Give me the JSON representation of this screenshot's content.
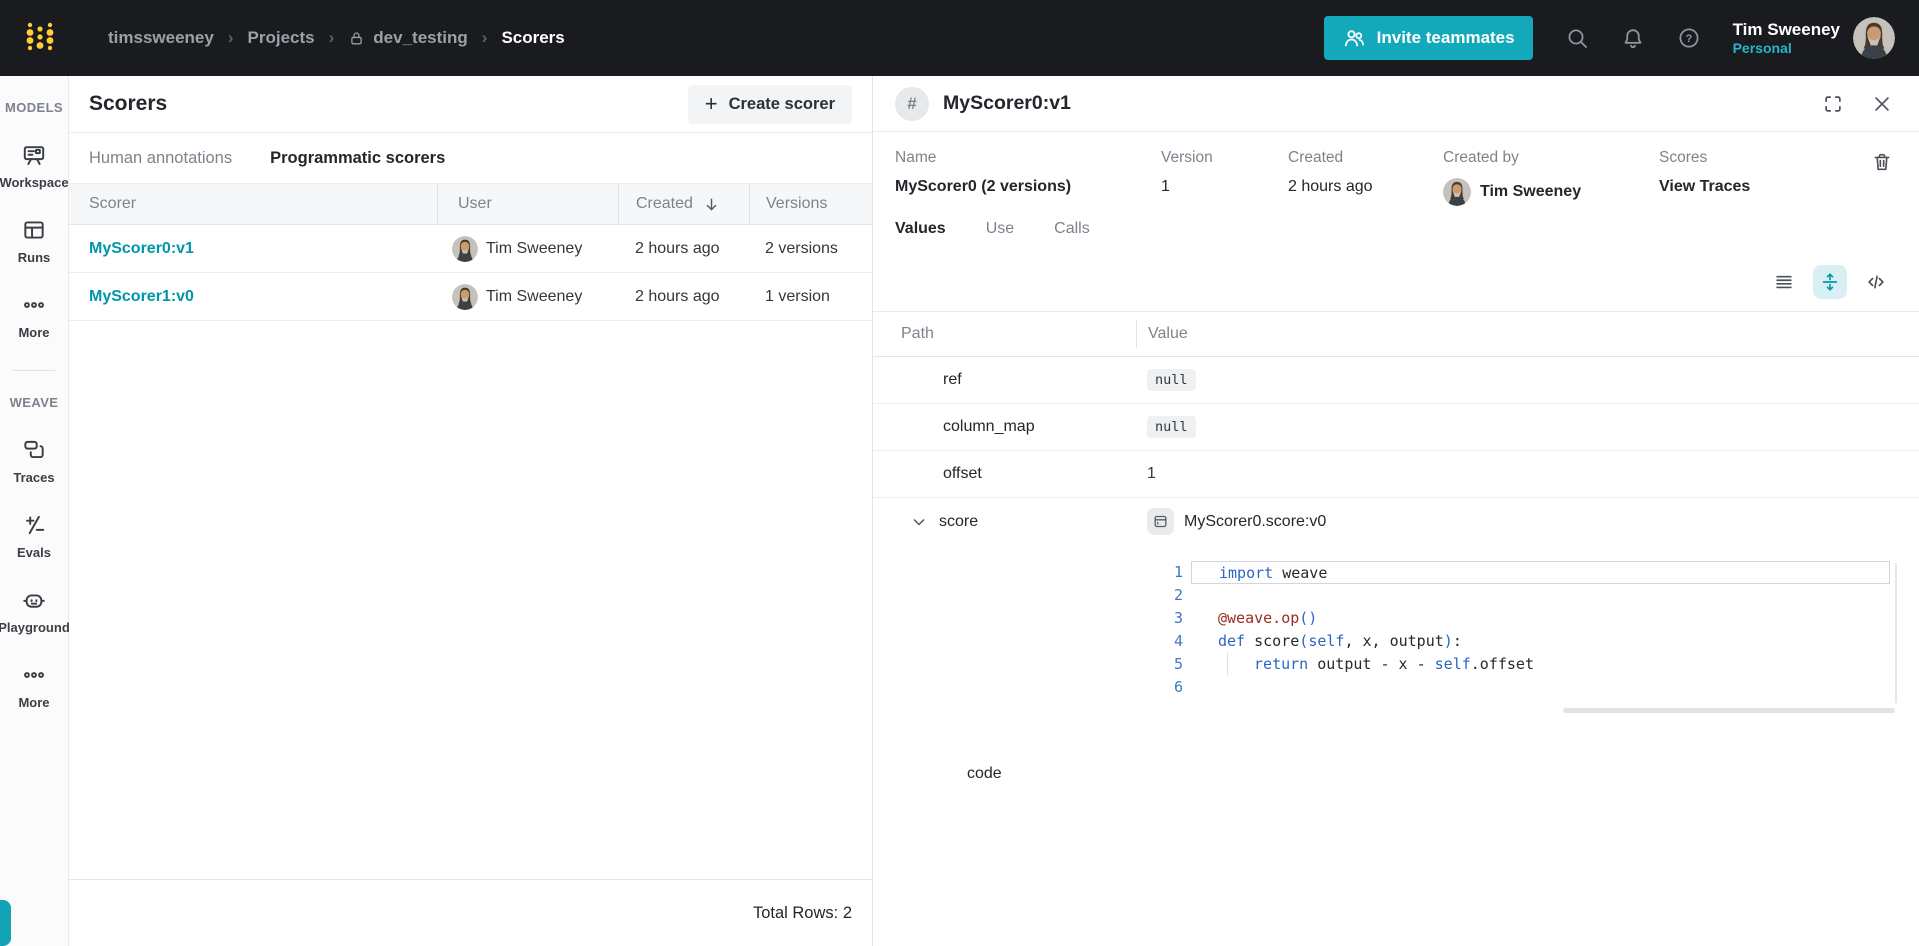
{
  "colors": {
    "teal_button": "#14a9ba",
    "teal_link": "#0097ab",
    "navbar_bg": "#191b1f"
  },
  "navbar": {
    "breadcrumb": [
      {
        "label": "timssweeney"
      },
      {
        "label": "Projects"
      },
      {
        "label": "dev_testing",
        "lock": true
      },
      {
        "label": "Scorers",
        "current": true
      }
    ],
    "invite_button": "Invite teammates",
    "user": {
      "name": "Tim Sweeney",
      "scope": "Personal"
    }
  },
  "sidebar": {
    "sections": [
      {
        "label": "MODELS",
        "items": [
          {
            "label": "Workspace",
            "icon": "workspace-icon"
          },
          {
            "label": "Runs",
            "icon": "runs-icon"
          },
          {
            "label": "More",
            "icon": "more-icon"
          }
        ]
      },
      {
        "label": "WEAVE",
        "items": [
          {
            "label": "Traces",
            "icon": "traces-icon"
          },
          {
            "label": "Evals",
            "icon": "evals-icon"
          },
          {
            "label": "Playground",
            "icon": "playground-icon"
          },
          {
            "label": "More",
            "icon": "more-icon"
          }
        ]
      }
    ]
  },
  "scorers": {
    "title": "Scorers",
    "create_button": "Create scorer",
    "tabs": [
      {
        "label": "Human annotations",
        "active": false
      },
      {
        "label": "Programmatic scorers",
        "active": true
      }
    ],
    "columns": [
      "Scorer",
      "User",
      "Created",
      "Versions"
    ],
    "sorted_column": "Created",
    "rows": [
      {
        "scorer": "MyScorer0:v1",
        "user": "Tim Sweeney",
        "created": "2 hours ago",
        "versions": "2 versions"
      },
      {
        "scorer": "MyScorer1:v0",
        "user": "Tim Sweeney",
        "created": "2 hours ago",
        "versions": "1 version"
      }
    ],
    "footer": "Total Rows: 2"
  },
  "detail": {
    "title": "MyScorer0:v1",
    "meta": [
      {
        "label": "Name",
        "value": "MyScorer0 (2 versions)",
        "bold": true
      },
      {
        "label": "Version",
        "value": "1"
      },
      {
        "label": "Created",
        "value": "2 hours ago"
      },
      {
        "label": "Created by",
        "value": "Tim Sweeney",
        "avatar": true,
        "bold": true
      },
      {
        "label": "Scores",
        "value": "View Traces",
        "bold": true,
        "link": true
      }
    ],
    "tabs": [
      {
        "label": "Values",
        "active": true
      },
      {
        "label": "Use",
        "active": false
      },
      {
        "label": "Calls",
        "active": false
      }
    ],
    "kv": {
      "columns": [
        "Path",
        "Value"
      ],
      "rows": [
        {
          "path": "ref",
          "value": "null",
          "kind": "code"
        },
        {
          "path": "column_map",
          "value": "null",
          "kind": "code"
        },
        {
          "path": "offset",
          "value": "1",
          "kind": "text"
        },
        {
          "path": "score",
          "value": "MyScorer0.score:v0",
          "kind": "op",
          "expanded": true
        }
      ]
    },
    "code": {
      "label": "code",
      "lines": [
        {
          "n": "1",
          "active": true,
          "toks": [
            [
              "import",
              "kw"
            ],
            [
              " weave",
              "tx"
            ]
          ]
        },
        {
          "n": "2",
          "toks": []
        },
        {
          "n": "3",
          "toks": [
            [
              "@weave.op",
              "dec"
            ],
            [
              "()",
              "pb"
            ]
          ]
        },
        {
          "n": "4",
          "toks": [
            [
              "def",
              "kw"
            ],
            [
              " score",
              "tx"
            ],
            [
              "(",
              "pb"
            ],
            [
              "self",
              "kw"
            ],
            [
              ", x, output",
              "tx"
            ],
            [
              ")",
              "pb"
            ],
            [
              ":",
              "tx"
            ]
          ]
        },
        {
          "n": "5",
          "toks": [
            [
              " ",
              "tx"
            ],
            [
              "",
              "ind"
            ],
            [
              "return",
              "kw"
            ],
            [
              " output - x - ",
              "tx"
            ],
            [
              "self",
              "kw"
            ],
            [
              ".offset",
              "tx"
            ]
          ]
        },
        {
          "n": "6",
          "toks": []
        }
      ]
    }
  }
}
